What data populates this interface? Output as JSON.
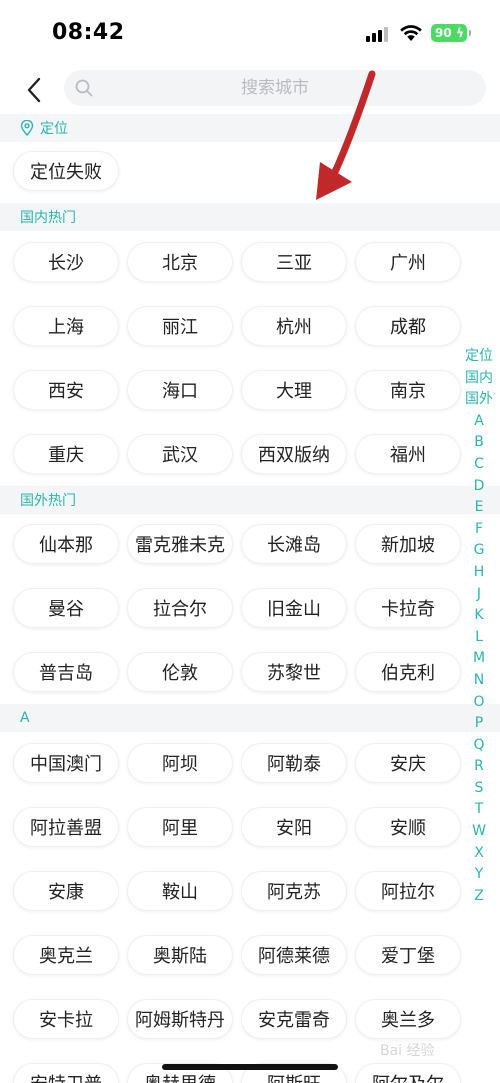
{
  "status_bar": {
    "time": "08:42",
    "battery": "90"
  },
  "search": {
    "placeholder": "搜索城市"
  },
  "sections": {
    "location": {
      "title": "定位",
      "chips": [
        "定位失败"
      ]
    },
    "domestic": {
      "title": "国内热门",
      "chips": [
        "长沙",
        "北京",
        "三亚",
        "广州",
        "上海",
        "丽江",
        "杭州",
        "成都",
        "西安",
        "海口",
        "大理",
        "南京",
        "重庆",
        "武汉",
        "西双版纳",
        "福州"
      ]
    },
    "overseas": {
      "title": "国外热门",
      "chips": [
        "仙本那",
        "雷克雅未克",
        "长滩岛",
        "新加坡",
        "曼谷",
        "拉合尔",
        "旧金山",
        "卡拉奇",
        "普吉岛",
        "伦敦",
        "苏黎世",
        "伯克利"
      ]
    },
    "a": {
      "title": "A",
      "chips": [
        "中国澳门",
        "阿坝",
        "阿勒泰",
        "安庆",
        "阿拉善盟",
        "阿里",
        "安阳",
        "安顺",
        "安康",
        "鞍山",
        "阿克苏",
        "阿拉尔",
        "奥克兰",
        "奥斯陆",
        "阿德莱德",
        "爱丁堡",
        "安卡拉",
        "阿姆斯特丹",
        "安克雷奇",
        "奥兰多",
        "安特卫普",
        "奥赫里德",
        "阿斯旺",
        "阿尔及尔"
      ]
    }
  },
  "alpha_index": [
    "定位",
    "国内",
    "国外",
    "A",
    "B",
    "C",
    "D",
    "E",
    "F",
    "G",
    "H",
    "J",
    "K",
    "L",
    "M",
    "N",
    "O",
    "P",
    "Q",
    "R",
    "S",
    "T",
    "W",
    "X",
    "Y",
    "Z"
  ],
  "watermark": "Bai 经验",
  "colors": {
    "accent": "#2bb5ad",
    "section_bg": "#f4f5f7",
    "arrow": "#c0282a"
  }
}
